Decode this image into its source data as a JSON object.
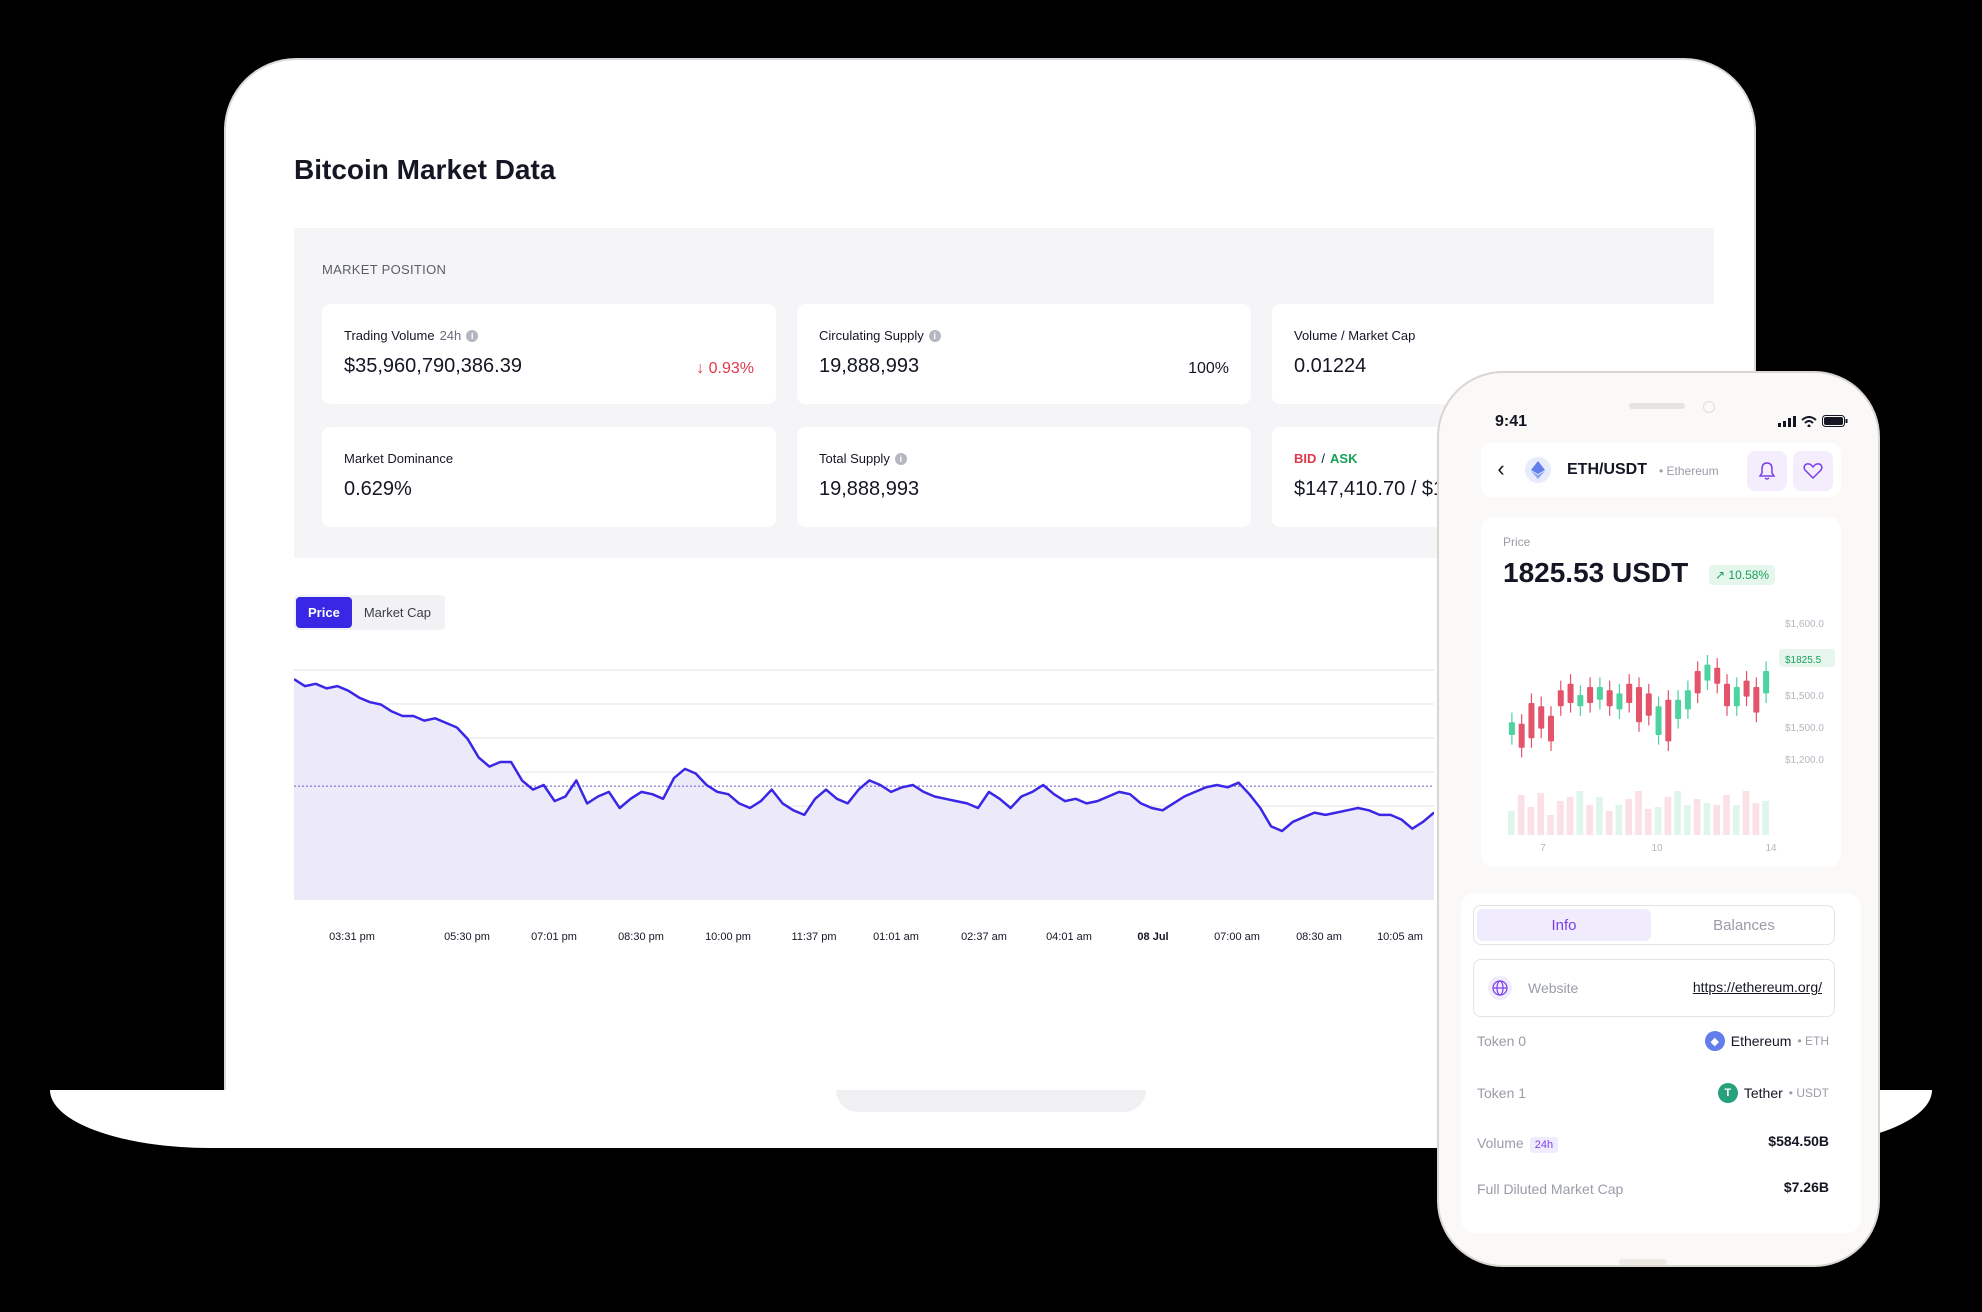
{
  "page": {
    "title": "Bitcoin Market Data"
  },
  "market": {
    "section_label": "MARKET POSITION",
    "trading_volume": {
      "label": "Trading Volume",
      "suffix": "24h",
      "value": "$35,960,790,386.39",
      "change": "↓ 0.93%"
    },
    "circulating_supply": {
      "label": "Circulating Supply",
      "value": "19,888,993",
      "aux": "100%"
    },
    "volume_market_cap": {
      "label": "Volume / Market Cap",
      "value": "0.01224"
    },
    "market_dominance": {
      "label": "Market Dominance",
      "value": "0.629%"
    },
    "total_supply": {
      "label": "Total Supply",
      "value": "19,888,993"
    },
    "bid_ask": {
      "bid_label": "BID",
      "sep": " / ",
      "ask_label": "ASK",
      "value": "$147,410.70 / $1"
    }
  },
  "tabs": {
    "price": "Price",
    "market_cap": "Market Cap"
  },
  "colors": {
    "accent": "#3a27e6",
    "down": "#e0384b",
    "up": "#19a05a",
    "candle_up": "#4cd3a0",
    "candle_down": "#e3546a",
    "purple": "#7b3fe4"
  },
  "chart_data": [
    {
      "type": "area",
      "x_ticks": [
        "03:31 pm",
        "05:30 pm",
        "07:01 pm",
        "08:30 pm",
        "10:00 pm",
        "11:37 pm",
        "01:01 am",
        "02:37 am",
        "04:01 am",
        "08 Jul",
        "07:00 am",
        "08:30 am",
        "10:05 am"
      ],
      "values": [
        96,
        93,
        94,
        92,
        93,
        91,
        88,
        86,
        85,
        82,
        80,
        80,
        78,
        79,
        77,
        75,
        70,
        62,
        58,
        60,
        60,
        52,
        48,
        50,
        43,
        45,
        52,
        42,
        45,
        47,
        40,
        44,
        47,
        46,
        44,
        53,
        57,
        55,
        50,
        47,
        46,
        42,
        40,
        43,
        48,
        42,
        39,
        37,
        44,
        48,
        44,
        42,
        48,
        52,
        50,
        47,
        49,
        50,
        47,
        45,
        44,
        43,
        42,
        40,
        47,
        44,
        40,
        45,
        47,
        50,
        46,
        43,
        44,
        42,
        43,
        45,
        47,
        46,
        42,
        40,
        39,
        42,
        45,
        47,
        49,
        50,
        49,
        51,
        46,
        40,
        32,
        30,
        34,
        36,
        38,
        37,
        38,
        39,
        40,
        39,
        37,
        37,
        35,
        31,
        34,
        38
      ],
      "mean_line": 49.5,
      "ylim": [
        0,
        100
      ],
      "grid": true
    },
    {
      "type": "candlestick",
      "price_ticks": [
        "$1,600.0",
        "$1825.5",
        "$1,500.0",
        "$1,500.0",
        "$1,200.0"
      ],
      "x_ticks": [
        "7",
        "10",
        "14"
      ],
      "candles": [
        [
          30,
          38
        ],
        [
          37,
          22
        ],
        [
          50,
          28
        ],
        [
          48,
          34
        ],
        [
          42,
          26
        ],
        [
          58,
          48
        ],
        [
          62,
          50
        ],
        [
          48,
          55
        ],
        [
          60,
          50
        ],
        [
          52,
          60
        ],
        [
          58,
          48
        ],
        [
          46,
          56
        ],
        [
          62,
          50
        ],
        [
          60,
          38
        ],
        [
          56,
          42
        ],
        [
          30,
          48
        ],
        [
          52,
          26
        ],
        [
          40,
          52
        ],
        [
          46,
          58
        ],
        [
          70,
          56
        ],
        [
          64,
          74
        ],
        [
          72,
          62
        ],
        [
          62,
          48
        ],
        [
          48,
          60
        ],
        [
          64,
          54
        ],
        [
          60,
          44
        ],
        [
          56,
          70
        ]
      ],
      "volumes": [
        24,
        40,
        28,
        42,
        20,
        34,
        38,
        44,
        30,
        38,
        24,
        30,
        36,
        44,
        26,
        28,
        38,
        44,
        30,
        36,
        32,
        30,
        40,
        30,
        44,
        32,
        34
      ]
    }
  ],
  "phone": {
    "time": "9:41",
    "pair": "ETH/USDT",
    "pair_sub": "• Ethereum",
    "price_label": "Price",
    "price_value": "1825.53 USDT",
    "price_change": "↗ 10.58%",
    "seg_info": "Info",
    "seg_balances": "Balances",
    "website_label": "Website",
    "website_link": "https://ethereum.org/",
    "token0_label": "Token 0",
    "token0_name": "Ethereum",
    "token0_symbol": "• ETH",
    "token1_label": "Token 1",
    "token1_name": "Tether",
    "token1_symbol": "• USDT",
    "volume_label": "Volume",
    "volume_badge": "24h",
    "volume_value": "$584.50B",
    "fdmc_label": "Full Diluted Market Cap",
    "fdmc_value": "$7.26B"
  }
}
